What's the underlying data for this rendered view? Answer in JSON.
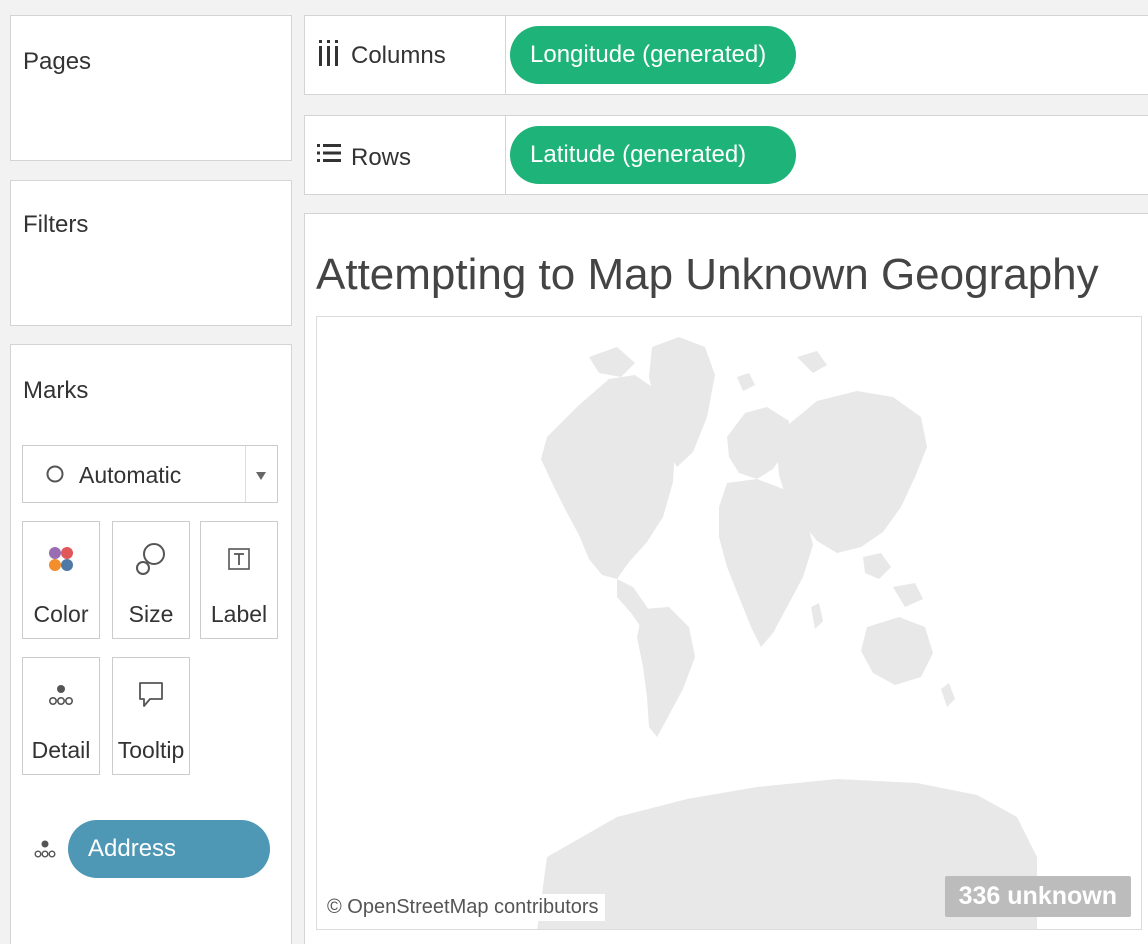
{
  "cards": {
    "pages_title": "Pages",
    "filters_title": "Filters",
    "marks_title": "Marks"
  },
  "marks": {
    "mark_type": "Automatic",
    "buttons": {
      "color": "Color",
      "size": "Size",
      "label": "Label",
      "detail": "Detail",
      "tooltip": "Tooltip"
    },
    "field_pill": "Address"
  },
  "shelves": {
    "columns_label": "Columns",
    "columns_pill": "Longitude (generated)",
    "rows_label": "Rows",
    "rows_pill": "Latitude (generated)"
  },
  "view": {
    "title": "Attempting to Map Unknown Geography",
    "attribution": "© OpenStreetMap contributors",
    "unknown_indicator": "336 unknown"
  },
  "colors": {
    "pill_green": "#1eb378",
    "pill_blue": "#4e98b5",
    "land": "#e8e8e8"
  }
}
